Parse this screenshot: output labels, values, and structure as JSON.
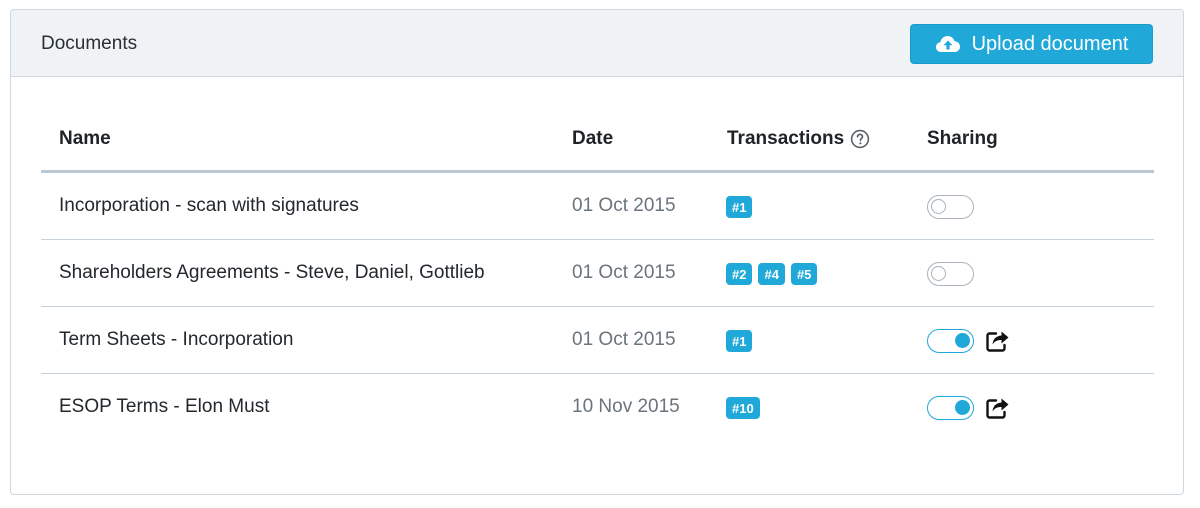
{
  "panel": {
    "title": "Documents",
    "upload_label": "Upload document"
  },
  "columns": {
    "name": "Name",
    "date": "Date",
    "transactions": "Transactions",
    "sharing": "Sharing"
  },
  "rows": [
    {
      "name": "Incorporation - scan with signatures",
      "date": "01 Oct 2015",
      "transactions": [
        "#1"
      ],
      "sharing": false
    },
    {
      "name": "Shareholders Agreements - Steve, Daniel, Gottlieb",
      "date": "01 Oct 2015",
      "transactions": [
        "#2",
        "#4",
        "#5"
      ],
      "sharing": false
    },
    {
      "name": "Term Sheets - Incorporation",
      "date": "01 Oct 2015",
      "transactions": [
        "#1"
      ],
      "sharing": true
    },
    {
      "name": "ESOP Terms - Elon Must",
      "date": "10 Nov 2015",
      "transactions": [
        "#10"
      ],
      "sharing": true
    }
  ],
  "icons": {
    "upload": "cloud-upload-icon",
    "help": "question-circle-icon",
    "share": "share-external-icon"
  },
  "colors": {
    "accent": "#20a8d8",
    "header_bg": "#f0f3f5"
  }
}
